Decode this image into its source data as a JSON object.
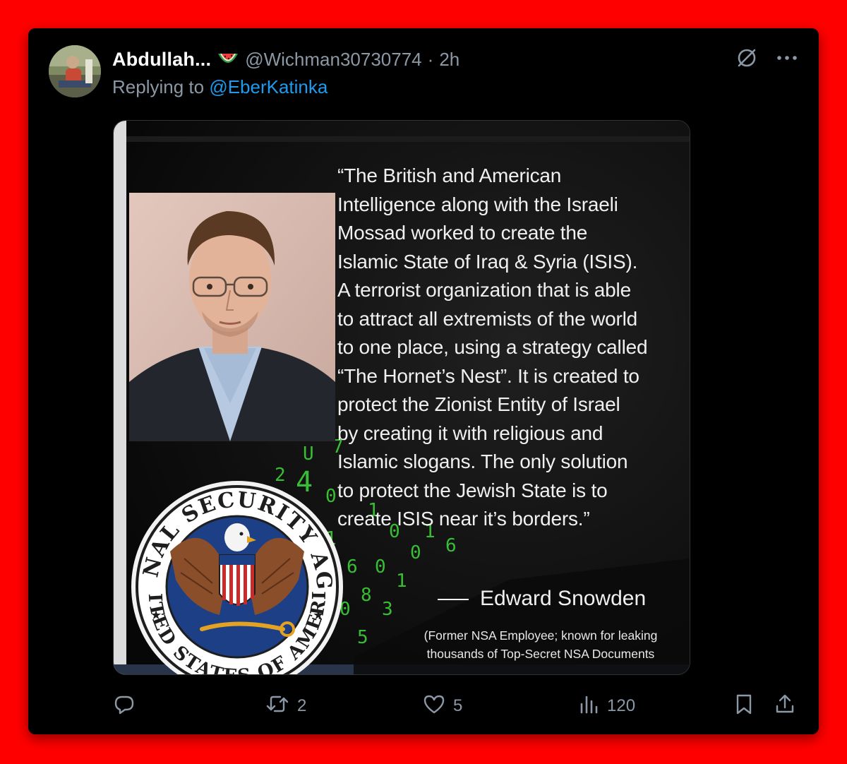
{
  "tweet": {
    "display_name": "Abdullah...",
    "handle": "@Wichman30730774",
    "separator": "·",
    "time": "2h",
    "reply_prefix": "Replying to",
    "reply_to": "@EberKatinka"
  },
  "media": {
    "quote": "“The British and American\nIntelligence along with the Israeli\nMossad worked to create the\nIslamic State of Iraq & Syria (ISIS).\nA terrorist organization that is able\nto attract all extremists of the world\nto one place, using a strategy called\n“The Hornet’s Nest”. It is created to\nprotect the Zionist Entity of Israel\nby creating it with religious and\nIslamic slogans. The only solution\nto protect the Jewish State is to\ncreate ISIS near it’s borders.”",
    "attribution": "Edward Snowden",
    "caption": "(Former NSA Employee; known for leaking\nthousands of Top-Secret NSA Documents",
    "seal_top_text": "NATIONAL SECURITY AGENCY",
    "seal_bottom_text": "UNITED STATES OF AMERICA"
  },
  "actions": {
    "reply_count": "",
    "retweet_count": "2",
    "like_count": "5",
    "views_count": "120"
  },
  "icons": {
    "grok": "grok-icon",
    "more": "more-icon",
    "reply": "reply-icon",
    "retweet": "retweet-icon",
    "like": "heart-icon",
    "views": "views-icon",
    "bookmark": "bookmark-icon",
    "share": "share-icon"
  },
  "colors": {
    "frame": "#ff0000",
    "card_bg": "#000000",
    "name": "#ffffff",
    "muted": "#8b98a5",
    "link": "#1d9bf0",
    "matrix_green": "#3fdc3a",
    "seal_blue": "#1d3f86"
  }
}
